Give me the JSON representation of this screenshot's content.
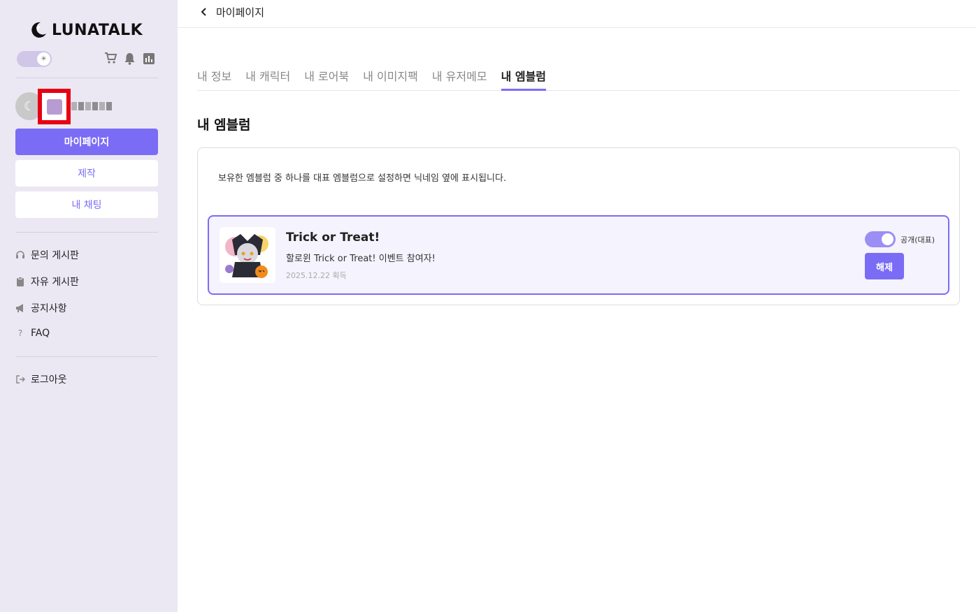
{
  "brand": {
    "name": "LUNATALK"
  },
  "sidebar": {
    "buttons": {
      "mypage": "마이페이지",
      "create": "제작",
      "my_chat": "내 채팅"
    },
    "menu": [
      {
        "label": "문의 게시판",
        "icon": "headset-icon"
      },
      {
        "label": "자유 게시판",
        "icon": "clipboard-icon"
      },
      {
        "label": "공지사항",
        "icon": "megaphone-icon"
      },
      {
        "label": "FAQ",
        "icon": "question-icon"
      }
    ],
    "logout": "로그아웃"
  },
  "header": {
    "title": "마이페이지"
  },
  "tabs": [
    {
      "label": "내 정보",
      "active": false
    },
    {
      "label": "내 캐릭터",
      "active": false
    },
    {
      "label": "내 로어북",
      "active": false
    },
    {
      "label": "내 이미지팩",
      "active": false
    },
    {
      "label": "내 유저메모",
      "active": false
    },
    {
      "label": "내 엠블럼",
      "active": true
    }
  ],
  "section": {
    "title": "내 엠블럼",
    "description": "보유한 엠블럼 중 하나를 대표 엠블럼으로 설정하면 닉네임 옆에 표시됩니다."
  },
  "emblem": {
    "name": "Trick or Treat!",
    "description": "할로윈 Trick or Treat! 이벤트 참여자!",
    "acquired": "2025.12.22 획득",
    "public_label": "공개(대표)",
    "public_on": true,
    "release_label": "해제"
  },
  "colors": {
    "accent": "#7b6cf6",
    "sidebar_bg": "#ebe8f4"
  }
}
